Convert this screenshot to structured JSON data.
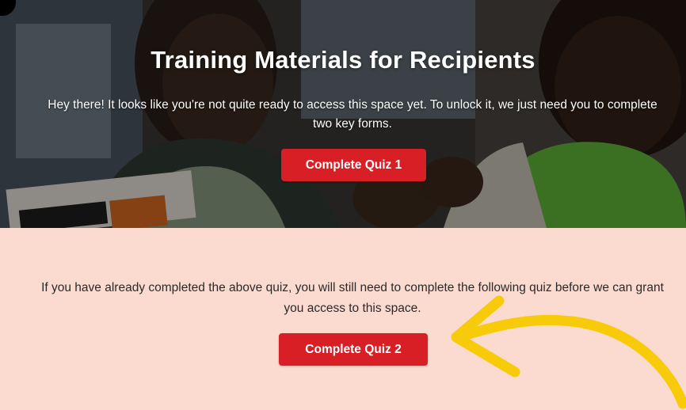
{
  "hero": {
    "title": "Training Materials for Recipients",
    "message": "Hey there! It looks like you're not quite ready to access this space yet. To unlock it, we just need you to complete two key forms.",
    "button_label": "Complete Quiz 1"
  },
  "lower": {
    "message": "If you have already completed the above quiz, you will still need to complete the following quiz before we can grant you access to this space.",
    "button_label": "Complete Quiz 2"
  },
  "colors": {
    "button": "#d81f26",
    "lower_background": "#fbdbcf",
    "arrow": "#f7cb0a"
  },
  "icons": {
    "annotation": "arrow-annotation-icon"
  }
}
